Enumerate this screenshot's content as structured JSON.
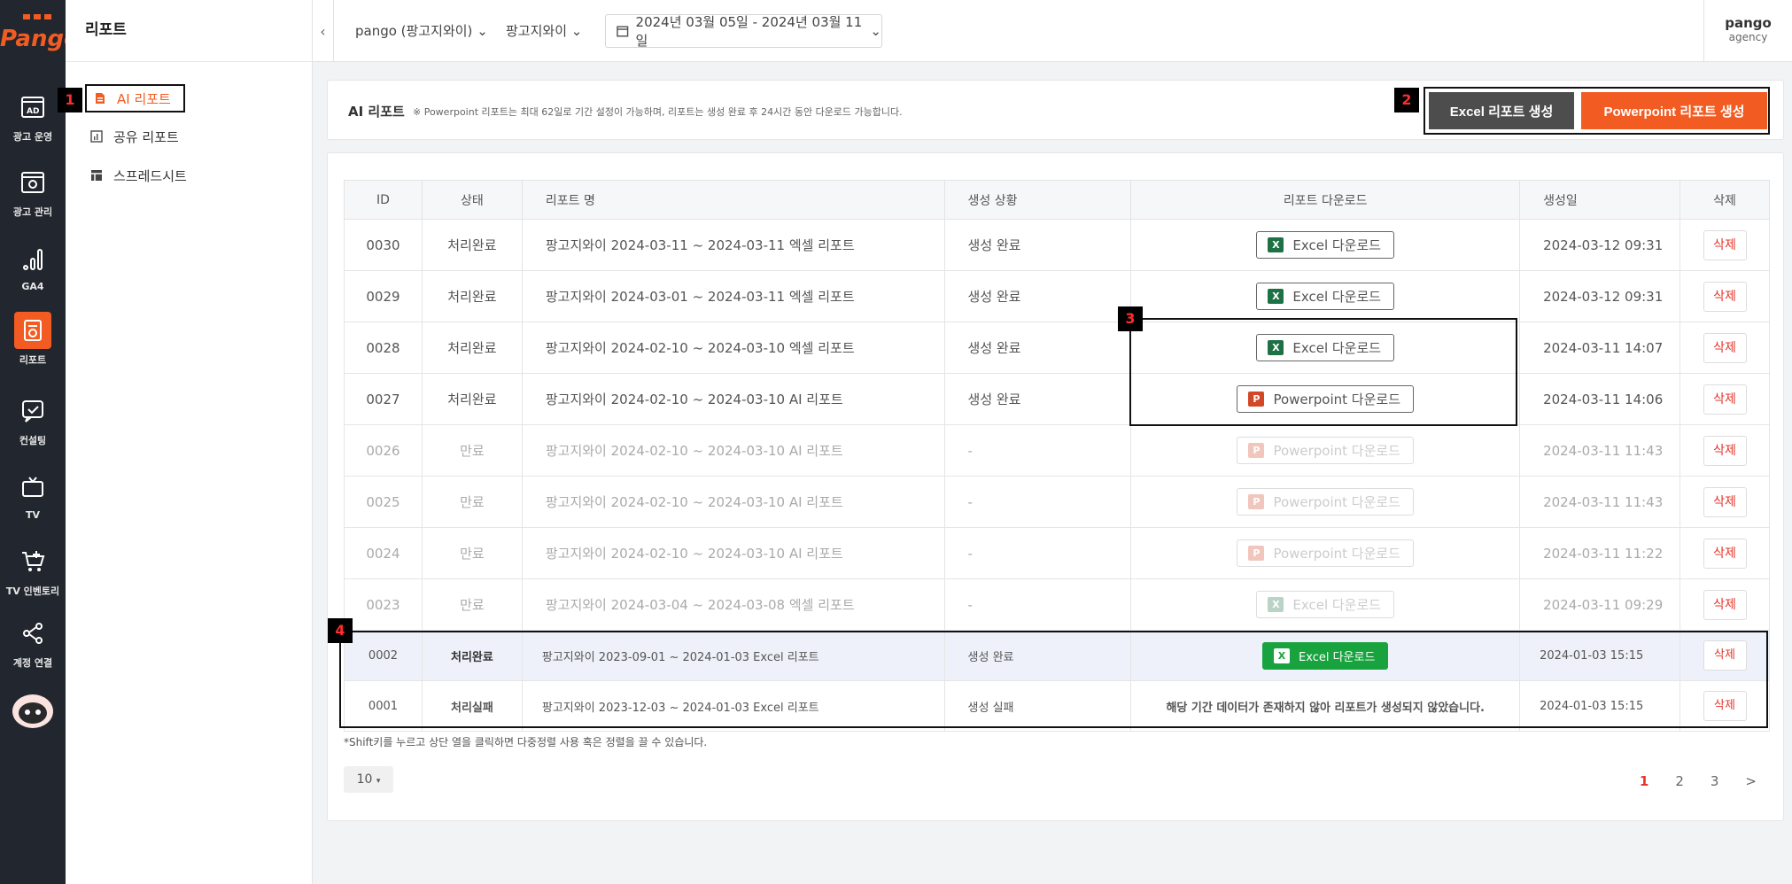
{
  "brand": {
    "logo_text": "Pango"
  },
  "rail": [
    {
      "label": "광고 운영",
      "icon": "ad-board-icon"
    },
    {
      "label": "광고 관리",
      "icon": "ad-settings-icon"
    },
    {
      "label": "GA4",
      "icon": "bar-chart-icon"
    },
    {
      "label": "리포트",
      "icon": "report-icon"
    },
    {
      "label": "컨설팅",
      "icon": "consulting-icon"
    },
    {
      "label": "TV",
      "icon": "tv-icon"
    },
    {
      "label": "TV 인벤토리",
      "icon": "cart-icon"
    },
    {
      "label": "계정 연결",
      "icon": "share-icon"
    }
  ],
  "subnav": {
    "title": "리포트",
    "items": [
      {
        "label": "AI 리포트",
        "icon": "document-icon"
      },
      {
        "label": "공유 리포트",
        "icon": "shared-chart-icon"
      },
      {
        "label": "스프레드시트",
        "icon": "spreadsheet-icon"
      }
    ]
  },
  "topbar": {
    "account": "pango (팡고지와이)",
    "brand": "팡고지와이",
    "date_range": "2024년 03월 05일 - 2024년 03월 11일",
    "user_name": "pango",
    "user_role": "agency"
  },
  "header": {
    "title": "AI 리포트",
    "note": "※ Powerpoint 리포트는 최대 62일로 기간 설정이 가능하며, 리포트는 생성 완료 후 24시간 동안 다운로드 가능합니다.",
    "excel_button": "Excel 리포트 생성",
    "ppt_button": "Powerpoint 리포트 생성"
  },
  "markers": {
    "m1": "1",
    "m2": "2",
    "m3": "3",
    "m4": "4"
  },
  "table": {
    "headers": {
      "id": "ID",
      "status": "상태",
      "name": "리포트 명",
      "progress": "생성 상황",
      "download": "리포트 다운로드",
      "created": "생성일",
      "delete": "삭제"
    },
    "rows": [
      {
        "id": "0030",
        "status": "처리완료",
        "name": "팡고지와이 2024-03-11 ~ 2024-03-11 엑셀 리포트",
        "progress": "생성 완료",
        "download": "Excel 다운로드",
        "created": "2024-03-12 09:31",
        "delete": "삭제"
      },
      {
        "id": "0029",
        "status": "처리완료",
        "name": "팡고지와이 2024-03-01 ~ 2024-03-11 엑셀 리포트",
        "progress": "생성 완료",
        "download": "Excel 다운로드",
        "created": "2024-03-12 09:31",
        "delete": "삭제"
      },
      {
        "id": "0028",
        "status": "처리완료",
        "name": "팡고지와이 2024-02-10 ~ 2024-03-10 엑셀 리포트",
        "progress": "생성 완료",
        "download": "Excel 다운로드",
        "created": "2024-03-11 14:07",
        "delete": "삭제"
      },
      {
        "id": "0027",
        "status": "처리완료",
        "name": "팡고지와이 2024-02-10 ~ 2024-03-10 AI 리포트",
        "progress": "생성 완료",
        "download": "Powerpoint 다운로드",
        "created": "2024-03-11 14:06",
        "delete": "삭제"
      },
      {
        "id": "0026",
        "status": "만료",
        "name": "팡고지와이 2024-02-10 ~ 2024-03-10 AI 리포트",
        "progress": "-",
        "download": "Powerpoint 다운로드",
        "created": "2024-03-11 11:43",
        "delete": "삭제"
      },
      {
        "id": "0025",
        "status": "만료",
        "name": "팡고지와이 2024-02-10 ~ 2024-03-10 AI 리포트",
        "progress": "-",
        "download": "Powerpoint 다운로드",
        "created": "2024-03-11 11:43",
        "delete": "삭제"
      },
      {
        "id": "0024",
        "status": "만료",
        "name": "팡고지와이 2024-02-10 ~ 2024-03-10 AI 리포트",
        "progress": "-",
        "download": "Powerpoint 다운로드",
        "created": "2024-03-11 11:22",
        "delete": "삭제"
      },
      {
        "id": "0023",
        "status": "만료",
        "name": "팡고지와이 2024-03-04 ~ 2024-03-08 엑셀 리포트",
        "progress": "-",
        "download": "Excel 다운로드",
        "created": "2024-03-11 09:29",
        "delete": "삭제"
      },
      {
        "id": "0002",
        "status": "처리완료",
        "name": "팡고지와이 2023-09-01 ~ 2024-01-03 Excel 리포트",
        "progress": "생성 완료",
        "download": "Excel 다운로드",
        "created": "2024-01-03 15:15",
        "delete": "삭제"
      },
      {
        "id": "0001",
        "status": "처리실패",
        "name": "팡고지와이 2023-12-03 ~ 2024-01-03 Excel 리포트",
        "progress": "생성 실패",
        "download": "해당 기간 데이터가 존재하지 않아 리포트가 생성되지 않았습니다.",
        "created": "2024-01-03 15:15",
        "delete": "삭제"
      }
    ]
  },
  "footnote": "*Shift키를 누르고 상단 열을 클릭하면 다중정렬 사용 혹은 정렬을 끌 수 있습니다.",
  "page_size": "10",
  "pager": {
    "pages": [
      "1",
      "2",
      "3"
    ],
    "next": ">"
  },
  "colors": {
    "accent": "#f25c22",
    "rail_bg": "#22262e",
    "danger": "#e4362b",
    "excel_green": "#18a33f"
  }
}
